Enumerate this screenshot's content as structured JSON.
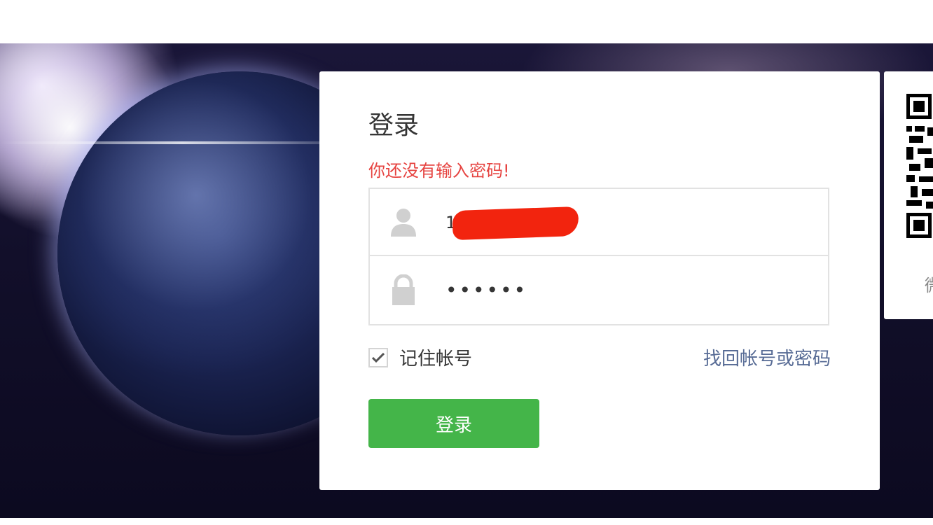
{
  "login": {
    "title": "登录",
    "error": "你还没有输入密码!",
    "username": {
      "value": "1"
    },
    "password": {
      "value": "••••••"
    },
    "remember_label": "记住帐号",
    "remember_checked": true,
    "find_link": "找回帐号或密码",
    "submit_label": "登录"
  },
  "qr": {
    "caption": "微"
  },
  "icons": {
    "user": "user-icon",
    "password": "lock-icon",
    "check": "check-icon"
  },
  "colors": {
    "primary": "#44b549",
    "error": "#e64340",
    "link": "#576b95",
    "redaction": "#f2240e"
  }
}
